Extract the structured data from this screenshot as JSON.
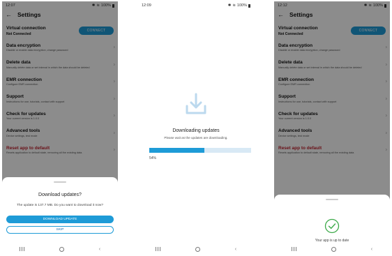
{
  "colors": {
    "accent": "#1e9bd7",
    "danger": "#c0222f",
    "success": "#3daa4a"
  },
  "screen1": {
    "time": "12:07",
    "battery": "100%",
    "title": "Settings",
    "connection": {
      "title": "Virtual connection",
      "status": "Not Connected",
      "button": "CONNECT"
    },
    "items": [
      {
        "title": "Data encryption",
        "desc": "Disable or enable data encryption, change password"
      },
      {
        "title": "Delete data",
        "desc": "Manually delete data or set interval in which the data should be deleted"
      },
      {
        "title": "EMR connection",
        "desc": "Configure EMR connection"
      },
      {
        "title": "Support",
        "desc": "Instructions for use, tutorials, contact with support"
      },
      {
        "title": "Check for updates",
        "desc": "Your current version is 1.0.0"
      },
      {
        "title": "Advanced tools",
        "desc": "Device settings, test mode"
      },
      {
        "title": "Reset app to default",
        "desc": "Resets application to default state, removing all the existing data."
      }
    ],
    "dialog": {
      "title": "Download updates?",
      "text": "The update is 137.7 MB. Do you want to download it now?",
      "primary": "DOWNLOAD UPDATE",
      "secondary": "SKIP"
    }
  },
  "screen2": {
    "time": "12:09",
    "battery": "100%",
    "icon": "download-icon",
    "title": "Downloading updates",
    "subtitle": "Please wait as the updates are downloading.",
    "progress": 0.54,
    "progress_label": "54%"
  },
  "screen3": {
    "time": "12:12",
    "battery": "100%",
    "title": "Settings",
    "connection": {
      "title": "Virtual connection",
      "status": "Not Connected",
      "button": "CONNECT"
    },
    "items": [
      {
        "title": "Data encryption",
        "desc": "Disable or enable data encryption, change password"
      },
      {
        "title": "Delete data",
        "desc": "Manually delete data or set interval in which the data should be deleted"
      },
      {
        "title": "EMR connection",
        "desc": "Configure EMR connection"
      },
      {
        "title": "Support",
        "desc": "Instructions for use, tutorials, contact with support"
      },
      {
        "title": "Check for updates",
        "desc": "Your current version is 1.0.0"
      },
      {
        "title": "Advanced tools",
        "desc": "Device settings, test mode"
      },
      {
        "title": "Reset app to default",
        "desc": "Resets application to default state, removing all the existing data."
      }
    ],
    "dialog": {
      "icon": "check-circle-icon",
      "text": "Your app is up to date"
    }
  }
}
